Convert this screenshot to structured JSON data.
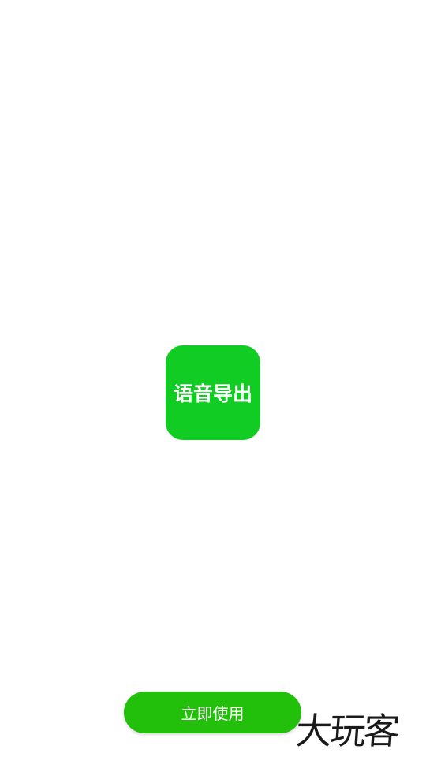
{
  "app": {
    "icon_label": "语音导出",
    "icon_color": "#11cc22"
  },
  "start_button": {
    "label": "立即使用",
    "color": "#22c00a"
  },
  "watermark": {
    "text": "大玩客"
  }
}
